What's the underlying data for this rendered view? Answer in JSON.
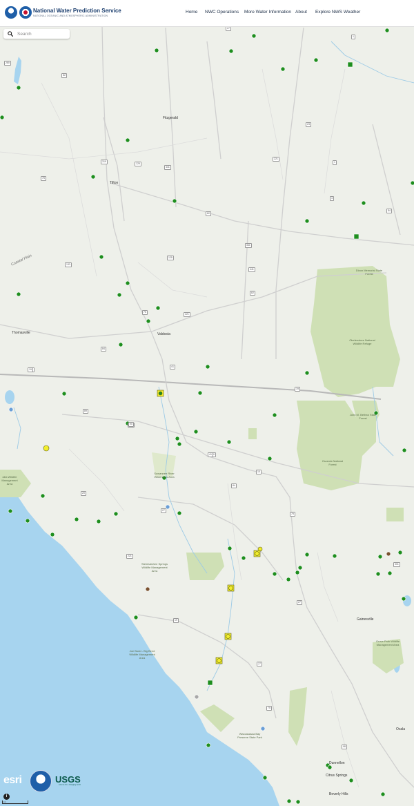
{
  "header": {
    "title": "National Water Prediction Service",
    "subtitle": "NATIONAL OCEANIC AND ATMOSPHERIC ADMINISTRATION",
    "nav": [
      "Home",
      "NWC Operations",
      "More Water Information",
      "About",
      "Explore NWS Weather"
    ]
  },
  "search": {
    "placeholder": "Search"
  },
  "map_labels": {
    "fitzgerald": "Fitzgerald",
    "tifton": "Tifton",
    "coastal_plain": "Coastal Plain",
    "thomasville": "Thomasville",
    "valdosta": "Valdosta",
    "dixon": "Dixon Memorial State Forest",
    "okefenokee": "Okefenokee National Wildlife Refuge",
    "john_betts": "John M. Bethea State Forest",
    "osceola": "Osceola National Forest",
    "suwannee": "Suwannee River Wilderness Area",
    "wildlife_area_left": "cilla Wildlife Management Area",
    "steinhatchee": "Steinhatchee Springs Wildlife Management Area",
    "gainesville": "Gainesville",
    "grove_park": "Grove Park Wildlife Management Area",
    "big_bend": "Joe Budd - Big Bend Wildlife Management Area",
    "waccasassa": "Waccasassa Bay Preserve State Park",
    "ocala": "Ocala",
    "dunnellon": "Dunnellon",
    "citrus_springs": "Citrus Springs",
    "beverly_hills": "Beverly Hills"
  },
  "route_shields": [
    "27",
    "1",
    "280",
    "82",
    "129",
    "441",
    "23",
    "221",
    "1",
    "319",
    "75",
    "82",
    "4",
    "341",
    "84",
    "82",
    "133",
    "125",
    "84",
    "75",
    "221",
    "41",
    "84",
    "19",
    "89",
    "221",
    "84",
    "90",
    "10",
    "10",
    "20",
    "27",
    "75",
    "221",
    "27",
    "19",
    "27",
    "75",
    "19",
    "301",
    "441",
    "98",
    "41"
  ],
  "colors": {
    "gauge_normal": "#1e8e1e",
    "gauge_action": "#f2ee2c",
    "gauge_old": "#7a5230",
    "gauge_no_flood": "#6a9ed6",
    "gauge_out_of_service": "#a8a8a8",
    "water": "#a7d4ef",
    "land": "#eef0ea",
    "park": "#cfe0b5"
  },
  "footer": {
    "esri": "esri",
    "usgs": "USGS",
    "usgs_tagline": "science for a changing world",
    "info": "i",
    "scale": "5 mi"
  }
}
